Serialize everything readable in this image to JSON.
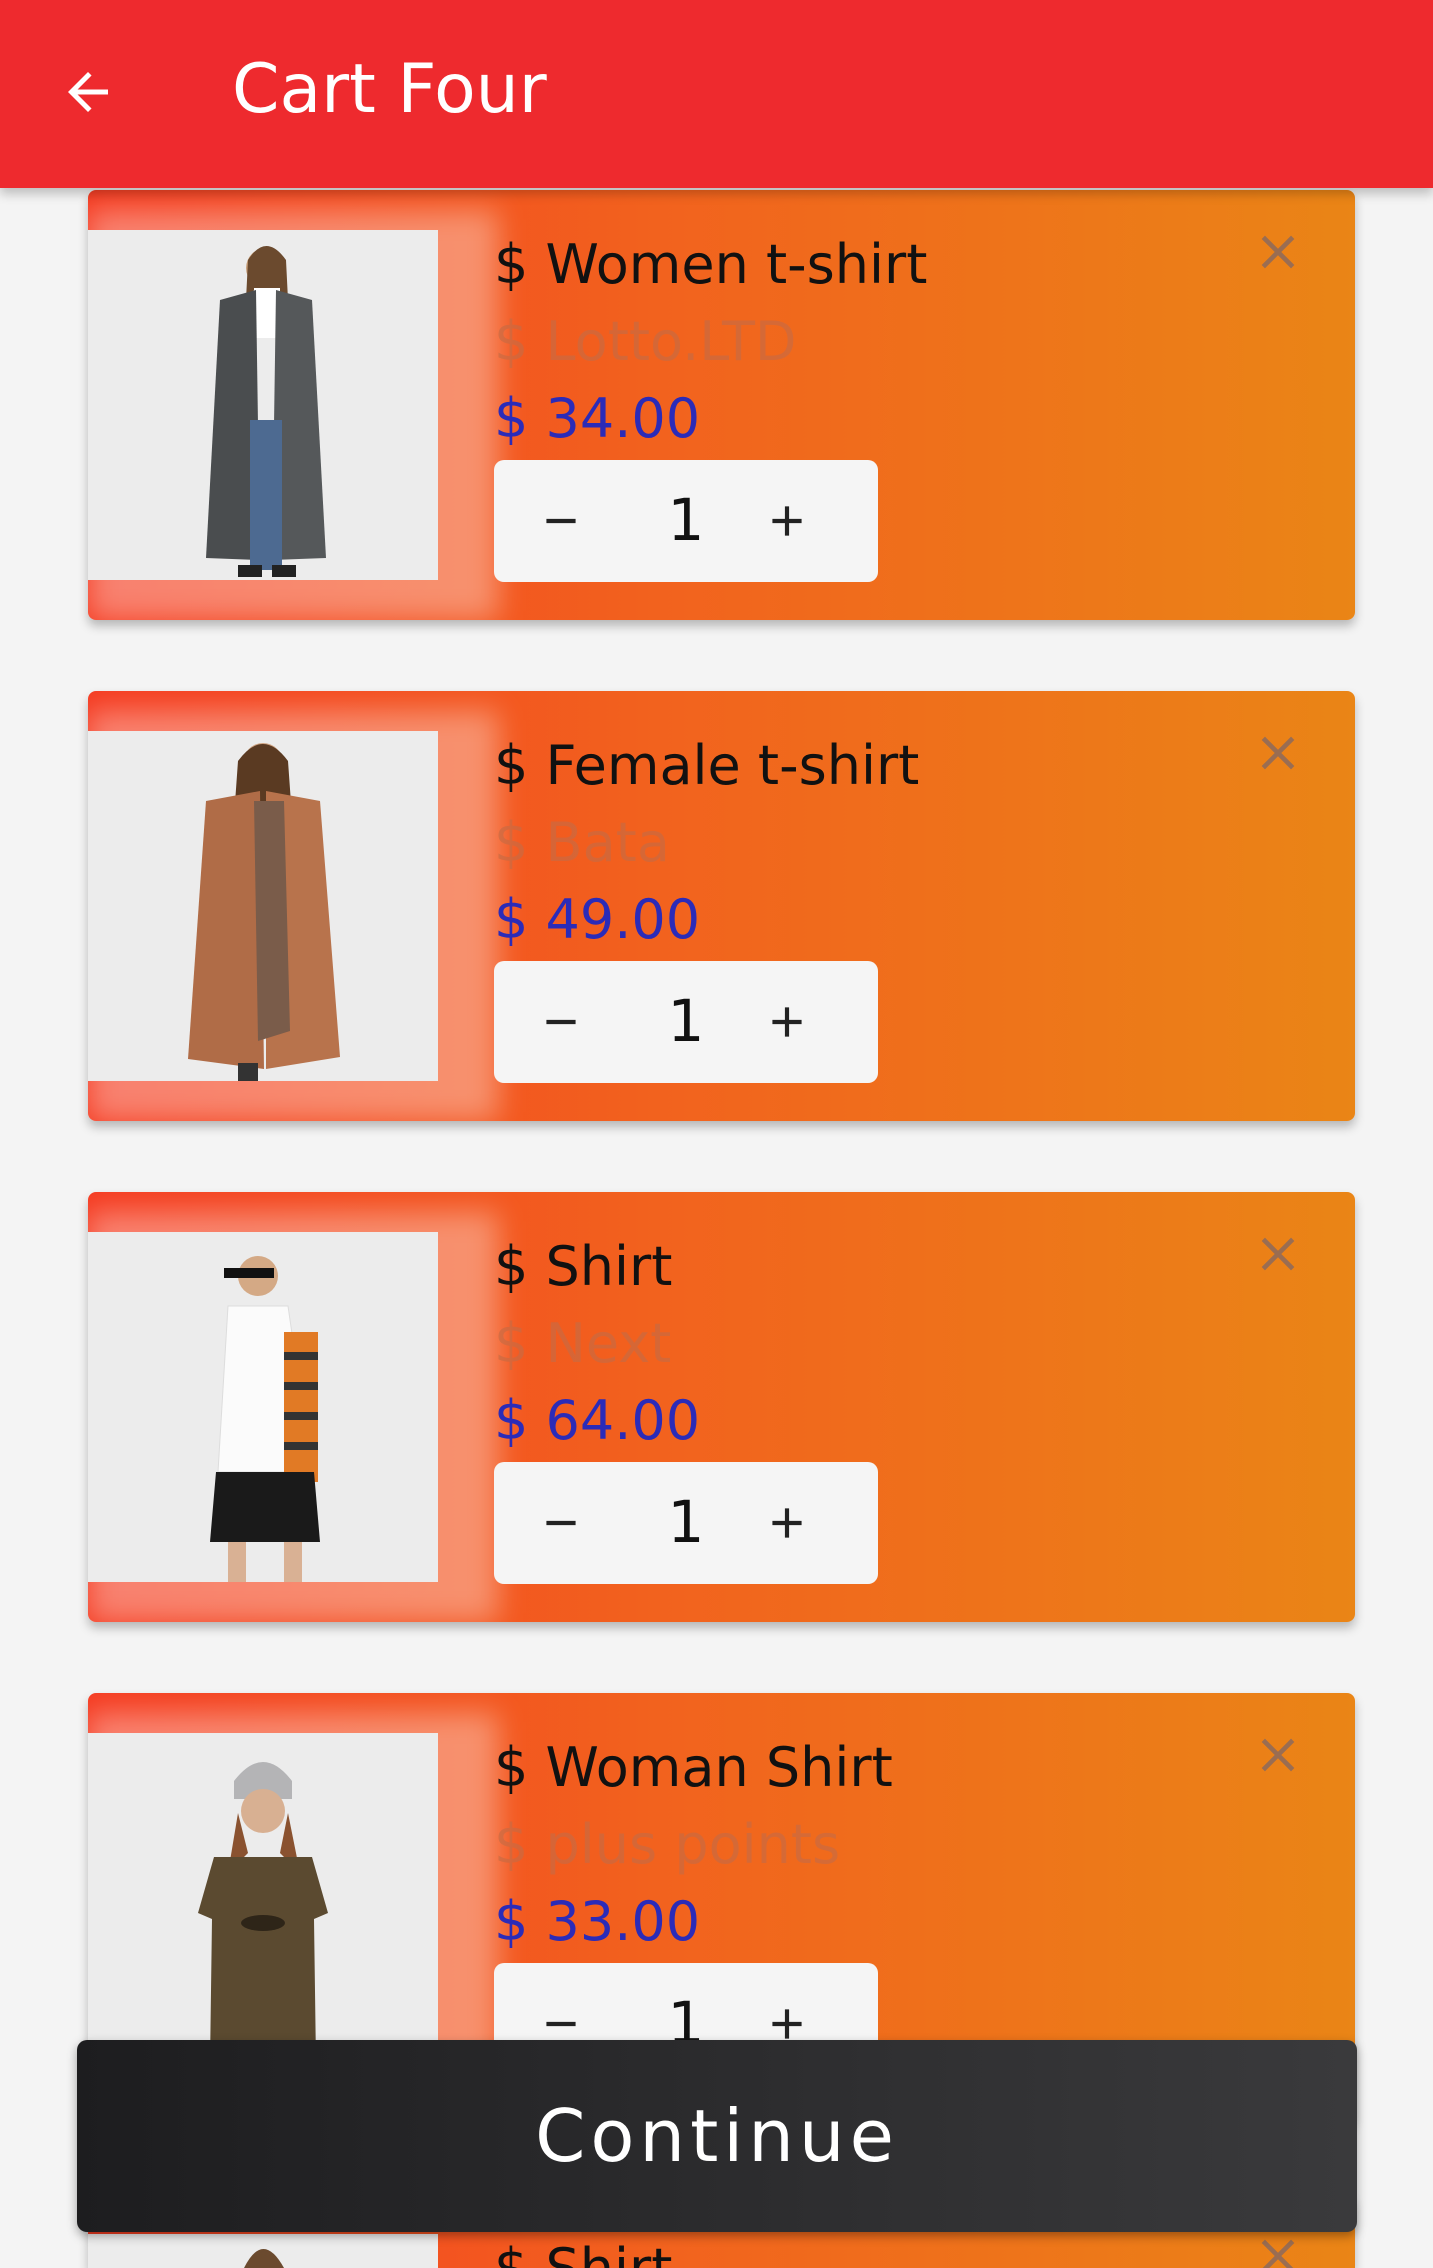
{
  "appbar": {
    "title": "Cart Four",
    "background": "#ee2a2e",
    "back_icon": "arrow-left-icon"
  },
  "cart_items": [
    {
      "name": "$ Women t-shirt",
      "brand": "$ Lotto.LTD",
      "price": "$ 34.00",
      "quantity": "1",
      "image": "woman in long grey coat"
    },
    {
      "name": "$ Female t-shirt",
      "brand": "$ Bata",
      "price": "$ 49.00",
      "quantity": "1",
      "image": "woman in camel coat"
    },
    {
      "name": "$ Shirt",
      "brand": "$ Next",
      "price": "$ 64.00",
      "quantity": "1",
      "image": "woman in white vest and striped sleeves"
    },
    {
      "name": "$ Woman Shirt",
      "brand": "$ plus points",
      "price": "$ 33.00",
      "quantity": "1",
      "image": "woman in brown t-shirt and beanie"
    },
    {
      "name": "$ Shirt",
      "brand": "",
      "price": "",
      "quantity": "",
      "image": "partially visible item"
    }
  ],
  "icons": {
    "remove": "close-icon",
    "decrement": "minus-icon",
    "increment": "plus-icon"
  },
  "colors": {
    "card_gradient_start": "#f53c22",
    "card_gradient_end": "#ea8516",
    "price": "#2b2bb8"
  },
  "footer": {
    "continue_label": "Continue"
  }
}
